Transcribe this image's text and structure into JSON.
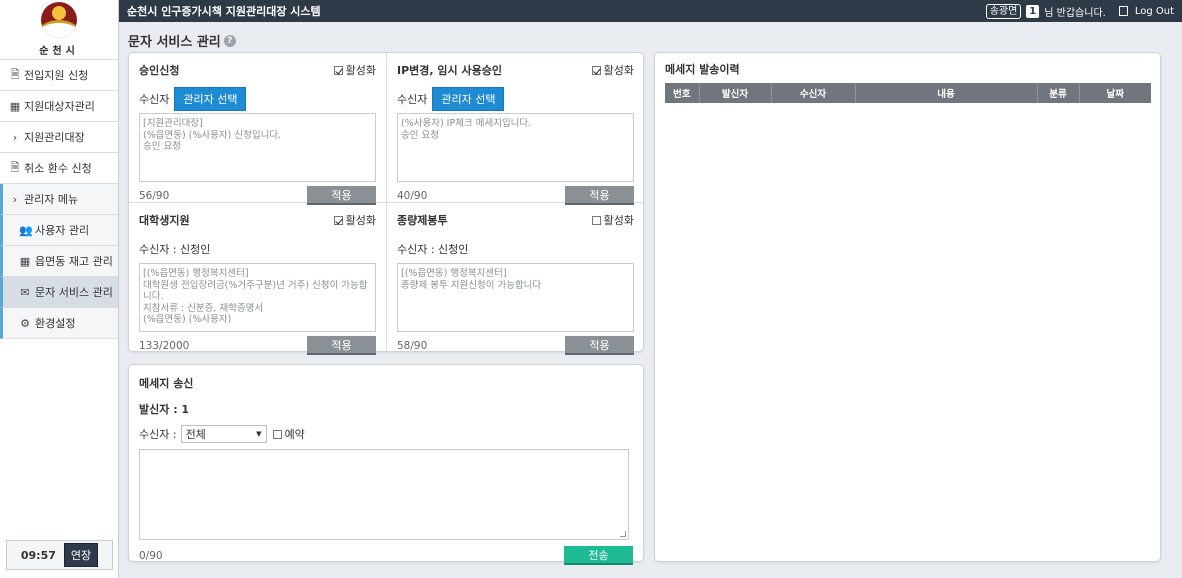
{
  "logo": {
    "text": "순천시"
  },
  "sidebar": {
    "items": [
      {
        "label": "전입지원 신청",
        "icon": "document-icon"
      },
      {
        "label": "지원대상자관리",
        "icon": "table-icon"
      },
      {
        "label": "지원관리대장",
        "icon": "chevron-right-icon"
      },
      {
        "label": "취소 환수 신청",
        "icon": "document-icon"
      },
      {
        "label": "관리자 메뉴",
        "icon": "chevron-right-icon"
      },
      {
        "label": "사용자 관리",
        "icon": "users-icon"
      },
      {
        "label": "읍면동 재고 관리",
        "icon": "table-icon"
      },
      {
        "label": "문자 서비스 관리",
        "icon": "envelope-icon"
      },
      {
        "label": "환경설정",
        "icon": "gear-icon"
      }
    ],
    "clock": "09:57",
    "extend_label": "연장"
  },
  "topbar": {
    "title": "순천시 인구증가시책 지원관리대장 시스템",
    "user": "송광면",
    "count": "1",
    "greeting": "님 반갑습니다.",
    "logout": "Log Out"
  },
  "page": {
    "title": "문자 서비스 관리"
  },
  "templates": [
    {
      "title": "승인신청",
      "active_label": "활성화",
      "active": true,
      "recipient_label": "수신자",
      "select_label": "관리자 선택",
      "text": "[지원관리대장]\n(%읍면동) (%사용자) 신청입니다.\n승인 요청",
      "counter": "56/90",
      "apply_label": "적용"
    },
    {
      "title": "IP변경, 임시 사용승인",
      "active_label": "활성화",
      "active": true,
      "recipient_label": "수신자",
      "select_label": "관리자 선택",
      "text": "(%사용자) IP체크 메세지입니다.\n승인 요청",
      "counter": "40/90",
      "apply_label": "적용"
    },
    {
      "title": "대학생지원",
      "active_label": "활성화",
      "active": true,
      "recipient_label": "수신자 : 신청인",
      "text": "[(%읍면동) 행정복지센터]\n대학원생 전입장려금(%거주구분)년 거주) 신청이 가능합니다.\n지참서류 : 신분증, 재학증명서\n(%읍면동) (%사용자)",
      "counter": "133/2000",
      "apply_label": "적용"
    },
    {
      "title": "종량제봉투",
      "active_label": "활성화",
      "active": false,
      "recipient_label": "수신자 : 신청인",
      "text": "[(%읍면동) 행정복지센터]\n종량제 봉투 지원신청이 가능합니다",
      "counter": "58/90",
      "apply_label": "적용"
    }
  ],
  "send": {
    "title": "메세지 송신",
    "sender_label": "발신자 : 1",
    "recipient_label": "수신자 :",
    "recipient_value": "전체",
    "reserve_label": "예약",
    "counter": "0/90",
    "send_label": "전송"
  },
  "history": {
    "title": "메세지 발송이력",
    "columns": [
      "번호",
      "발신자",
      "수신자",
      "내용",
      "분류",
      "날짜"
    ]
  }
}
